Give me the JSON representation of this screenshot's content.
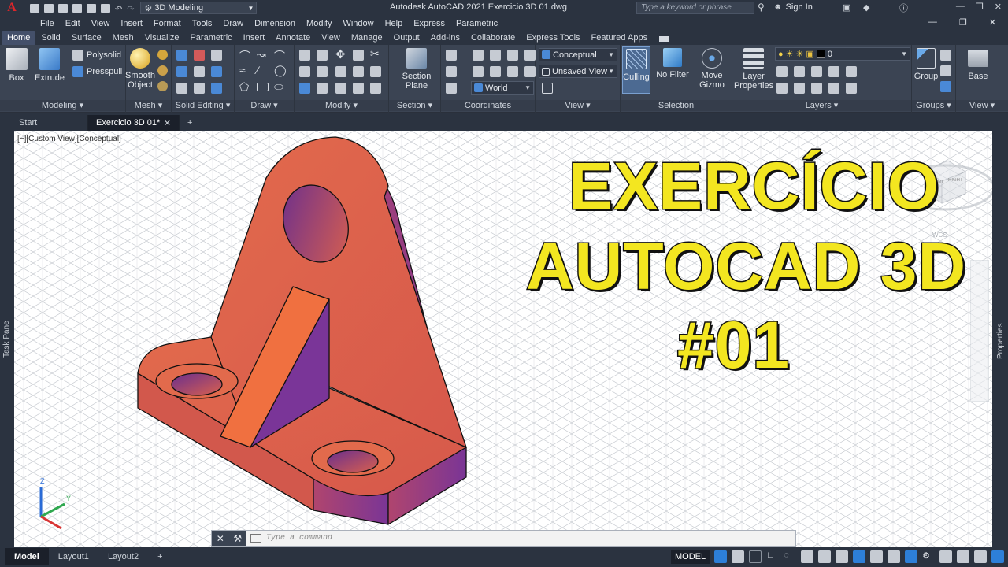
{
  "titlebar": {
    "logo": "A",
    "workspace": "3D Modeling",
    "title": "Autodesk AutoCAD 2021   Exercicio 3D 01.dwg",
    "search_placeholder": "Type a keyword or phrase",
    "signin": "Sign In"
  },
  "menubar": [
    "File",
    "Edit",
    "View",
    "Insert",
    "Format",
    "Tools",
    "Draw",
    "Dimension",
    "Modify",
    "Window",
    "Help",
    "Express",
    "Parametric"
  ],
  "ribbon_tabs": [
    "Home",
    "Solid",
    "Surface",
    "Mesh",
    "Visualize",
    "Parametric",
    "Insert",
    "Annotate",
    "View",
    "Manage",
    "Output",
    "Add-ins",
    "Collaborate",
    "Express Tools",
    "Featured Apps"
  ],
  "ribbon": {
    "box": "Box",
    "extrude": "Extrude",
    "polysolid": "Polysolid",
    "presspull": "Presspull",
    "smooth_object_1": "Smooth",
    "smooth_object_2": "Object",
    "section_plane_1": "Section",
    "section_plane_2": "Plane",
    "visual_style": "Conceptual",
    "named_view": "Unsaved View",
    "ucs": "World",
    "culling": "Culling",
    "no_filter": "No Filter",
    "move_gizmo_1": "Move",
    "move_gizmo_2": "Gizmo",
    "layer_props_1": "Layer",
    "layer_props_2": "Properties",
    "layer_current": "0",
    "group": "Group",
    "base": "Base",
    "panels": {
      "modeling": "Modeling",
      "mesh": "Mesh",
      "solid_editing": "Solid Editing",
      "draw": "Draw",
      "modify": "Modify",
      "section": "Section",
      "coordinates": "Coordinates",
      "view": "View",
      "selection": "Selection",
      "layers": "Layers",
      "groups": "Groups",
      "view2": "View"
    }
  },
  "doc_tabs": {
    "start": "Start",
    "active": "Exercicio 3D 01*",
    "add": "+"
  },
  "viewport": {
    "label": "[−][Custom View][Conceptual]",
    "headline": [
      "EXERCÍCIO",
      "AUTOCAD 3D",
      "#01"
    ],
    "viewcube": {
      "front": "FRONT",
      "right": "RIGHT",
      "wcs": "WCS"
    },
    "axis": {
      "z": "Z",
      "y": "Y"
    }
  },
  "side": {
    "left": "Task Pane",
    "right": "Properties"
  },
  "command": {
    "placeholder": "Type a command"
  },
  "status": {
    "model_tab": "Model",
    "layout1": "Layout1",
    "layout2": "Layout2",
    "add": "+",
    "model": "MODEL"
  },
  "colors": {
    "part_face": "#e0604a",
    "part_side": "#8a3a90",
    "rib": "#f07040",
    "headline": "#f3e620",
    "bg_dark": "#2b3340"
  }
}
